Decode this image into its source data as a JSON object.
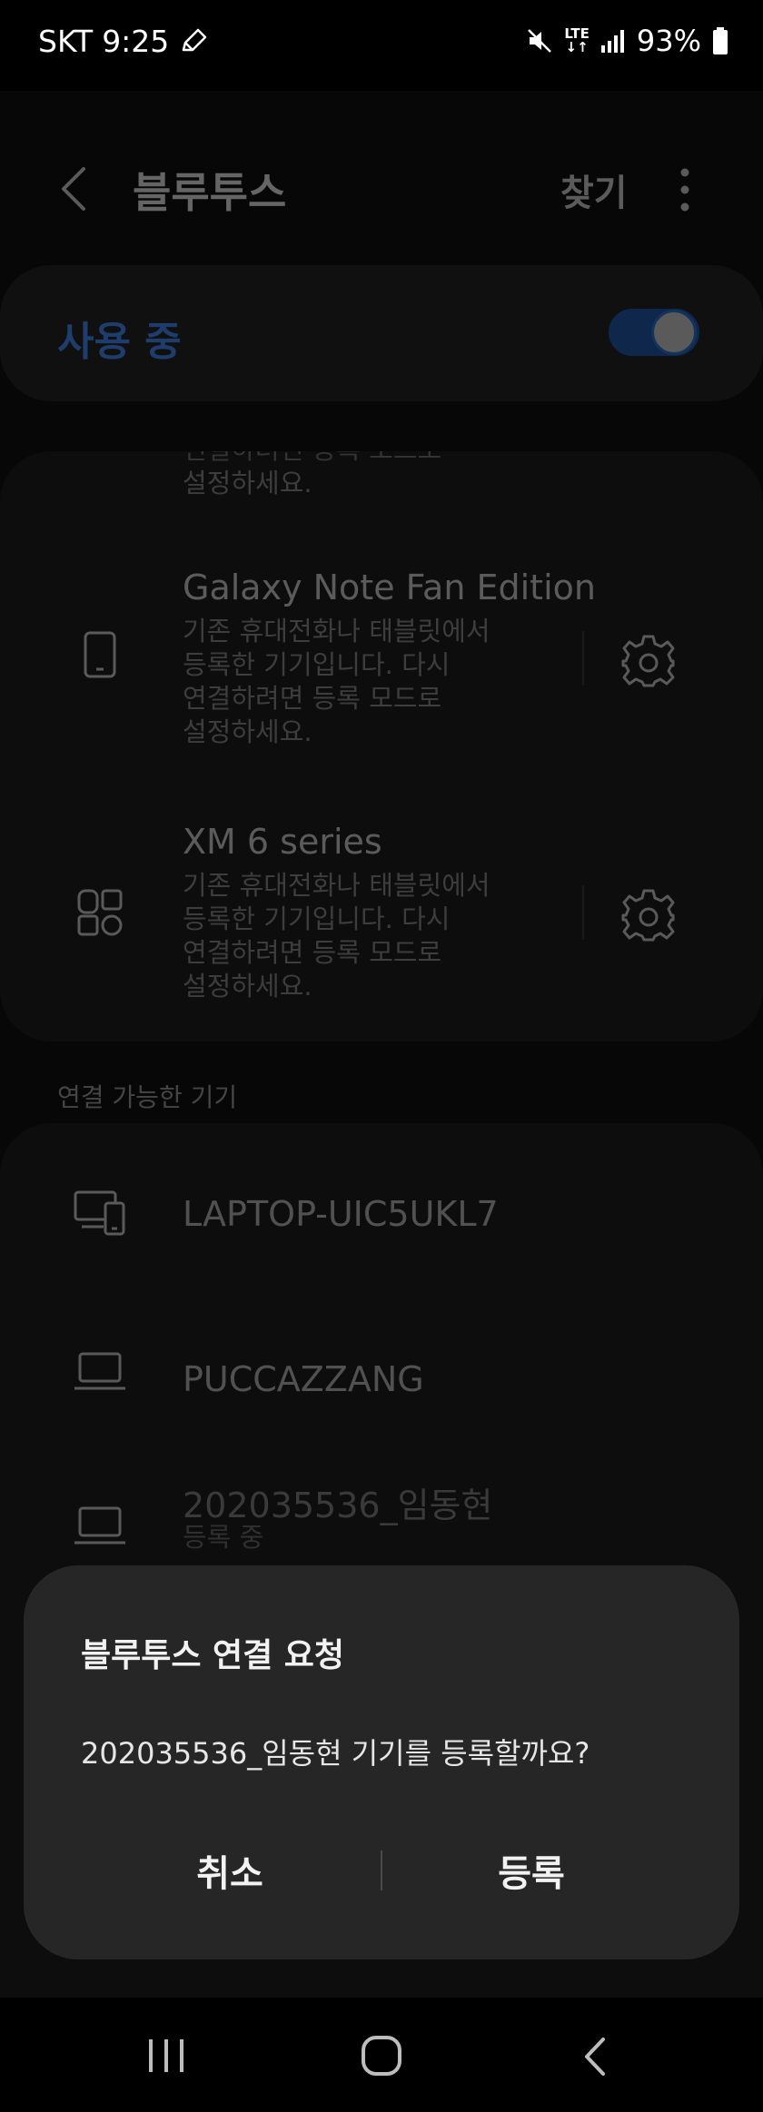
{
  "status_bar": {
    "carrier": "SKT",
    "time": "9:25",
    "network_top": "LTE",
    "network_bottom": "↓↑",
    "battery": "93%"
  },
  "header": {
    "title": "블루투스",
    "find_label": "찾기"
  },
  "toggle": {
    "label": "사용 중",
    "state": "on",
    "accent": "#2f5ea6"
  },
  "paired_devices": [
    {
      "desc_partial": "설정하세요."
    },
    {
      "name": "Galaxy Note Fan Edition",
      "description": "기존 휴대전화나 태블릿에서\n등록한 기기입니다. 다시\n연결하려면 등록 모드로\n설정하세요.",
      "icon": "phone-icon"
    },
    {
      "name": "XM 6 series",
      "description": "기존 휴대전화나 태블릿에서\n등록한 기기입니다. 다시\n연결하려면 등록 모드로\n설정하세요.",
      "icon": "earbuds-icon"
    }
  ],
  "available": {
    "section_label": "연결 가능한 기기",
    "devices": [
      {
        "name": "LAPTOP-UIC5UKL7",
        "icon": "computer-phone-icon"
      },
      {
        "name": "PUCCAZZANG",
        "icon": "laptop-icon"
      },
      {
        "name": "202035536_임동현",
        "status": "등록 중",
        "icon": "laptop-icon"
      }
    ]
  },
  "dialog": {
    "title": "블루투스 연결 요청",
    "message": "202035536_임동현 기기를 등록할까요?",
    "cancel_label": "취소",
    "register_label": "등록"
  }
}
